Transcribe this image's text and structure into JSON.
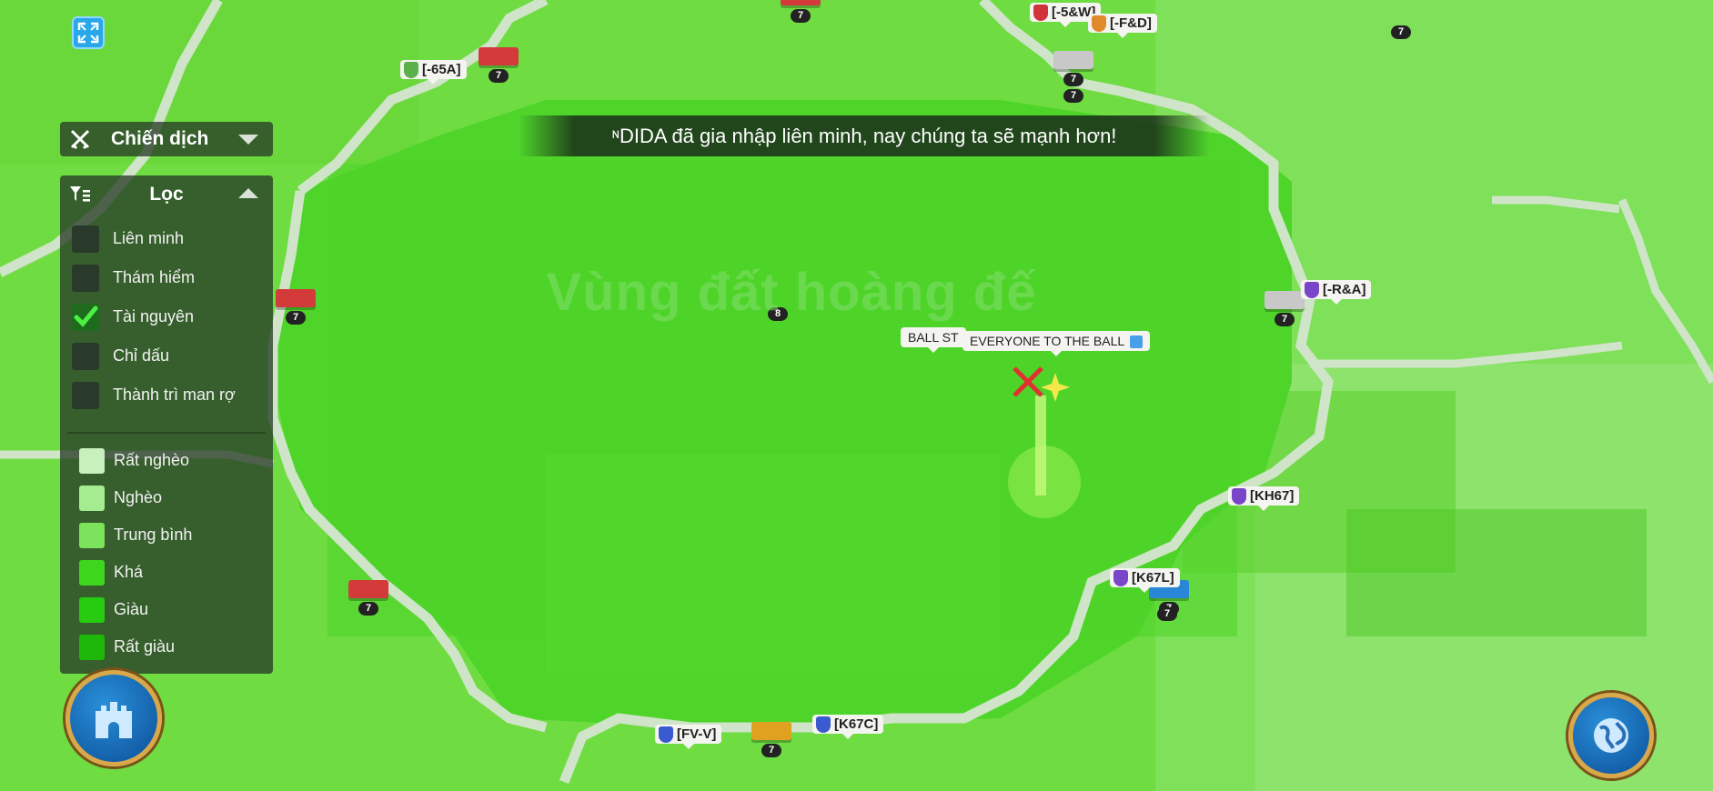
{
  "colors": {
    "map_inner": "#54d92f",
    "map_outer": "#7bdc4a",
    "road": "#cfe4c8",
    "wealth_very_poor": "#c8f0bd",
    "wealth_poor": "#a5ec90",
    "wealth_average": "#7ce45c",
    "wealth_fair": "#3dd61d",
    "wealth_rich": "#27cc10",
    "wealth_very_rich": "#1db80a"
  },
  "top_left": {
    "expand_icon": "fullscreen-expand-icon"
  },
  "campaign": {
    "label": "Chiến dịch",
    "icon": "crossed-swords-icon"
  },
  "filter": {
    "title": "Lọc",
    "options": [
      {
        "label": "Liên minh",
        "checked": false
      },
      {
        "label": "Thám hiểm",
        "checked": false
      },
      {
        "label": "Tài nguyên",
        "checked": true
      },
      {
        "label": "Chỉ dấu",
        "checked": false
      },
      {
        "label": "Thành trì man rợ",
        "checked": false
      }
    ],
    "wealth": [
      {
        "label": "Rất nghèo"
      },
      {
        "label": "Nghèo"
      },
      {
        "label": "Trung bình"
      },
      {
        "label": "Khá"
      },
      {
        "label": "Giàu"
      },
      {
        "label": "Rất giàu"
      }
    ]
  },
  "banner": {
    "text": "ᶰDIDA đã gia nhập liên minh, nay chúng ta sẽ mạnh hơn!"
  },
  "region_name": "Vùng đất hoàng đế",
  "map": {
    "tags": [
      {
        "label": "[-65A]",
        "shield": "#5ab04a"
      },
      {
        "label": "[-5&W]",
        "shield": "#d0343a"
      },
      {
        "label": "[-F&D]",
        "shield": "#e08a2a"
      },
      {
        "label": "[-R&A]",
        "shield": "#7a45c8"
      },
      {
        "label": "[KH67]",
        "shield": "#7a45c8"
      },
      {
        "label": "[K67L]",
        "shield": "#7a45c8"
      },
      {
        "label": "[FV-V]",
        "shield": "#3a5ad0"
      },
      {
        "label": "[K67C]",
        "shield": "#3a5ad0"
      }
    ],
    "flags": [
      {
        "label": "BALL ST"
      },
      {
        "label": "EVERYONE TO THE BALL"
      }
    ],
    "levels": [
      "7",
      "7",
      "7",
      "7",
      "7",
      "8",
      "7",
      "7",
      "7",
      "7",
      "7",
      "7"
    ]
  },
  "buttons": {
    "castle_icon": "castle-icon",
    "globe_icon": "globe-icon"
  }
}
